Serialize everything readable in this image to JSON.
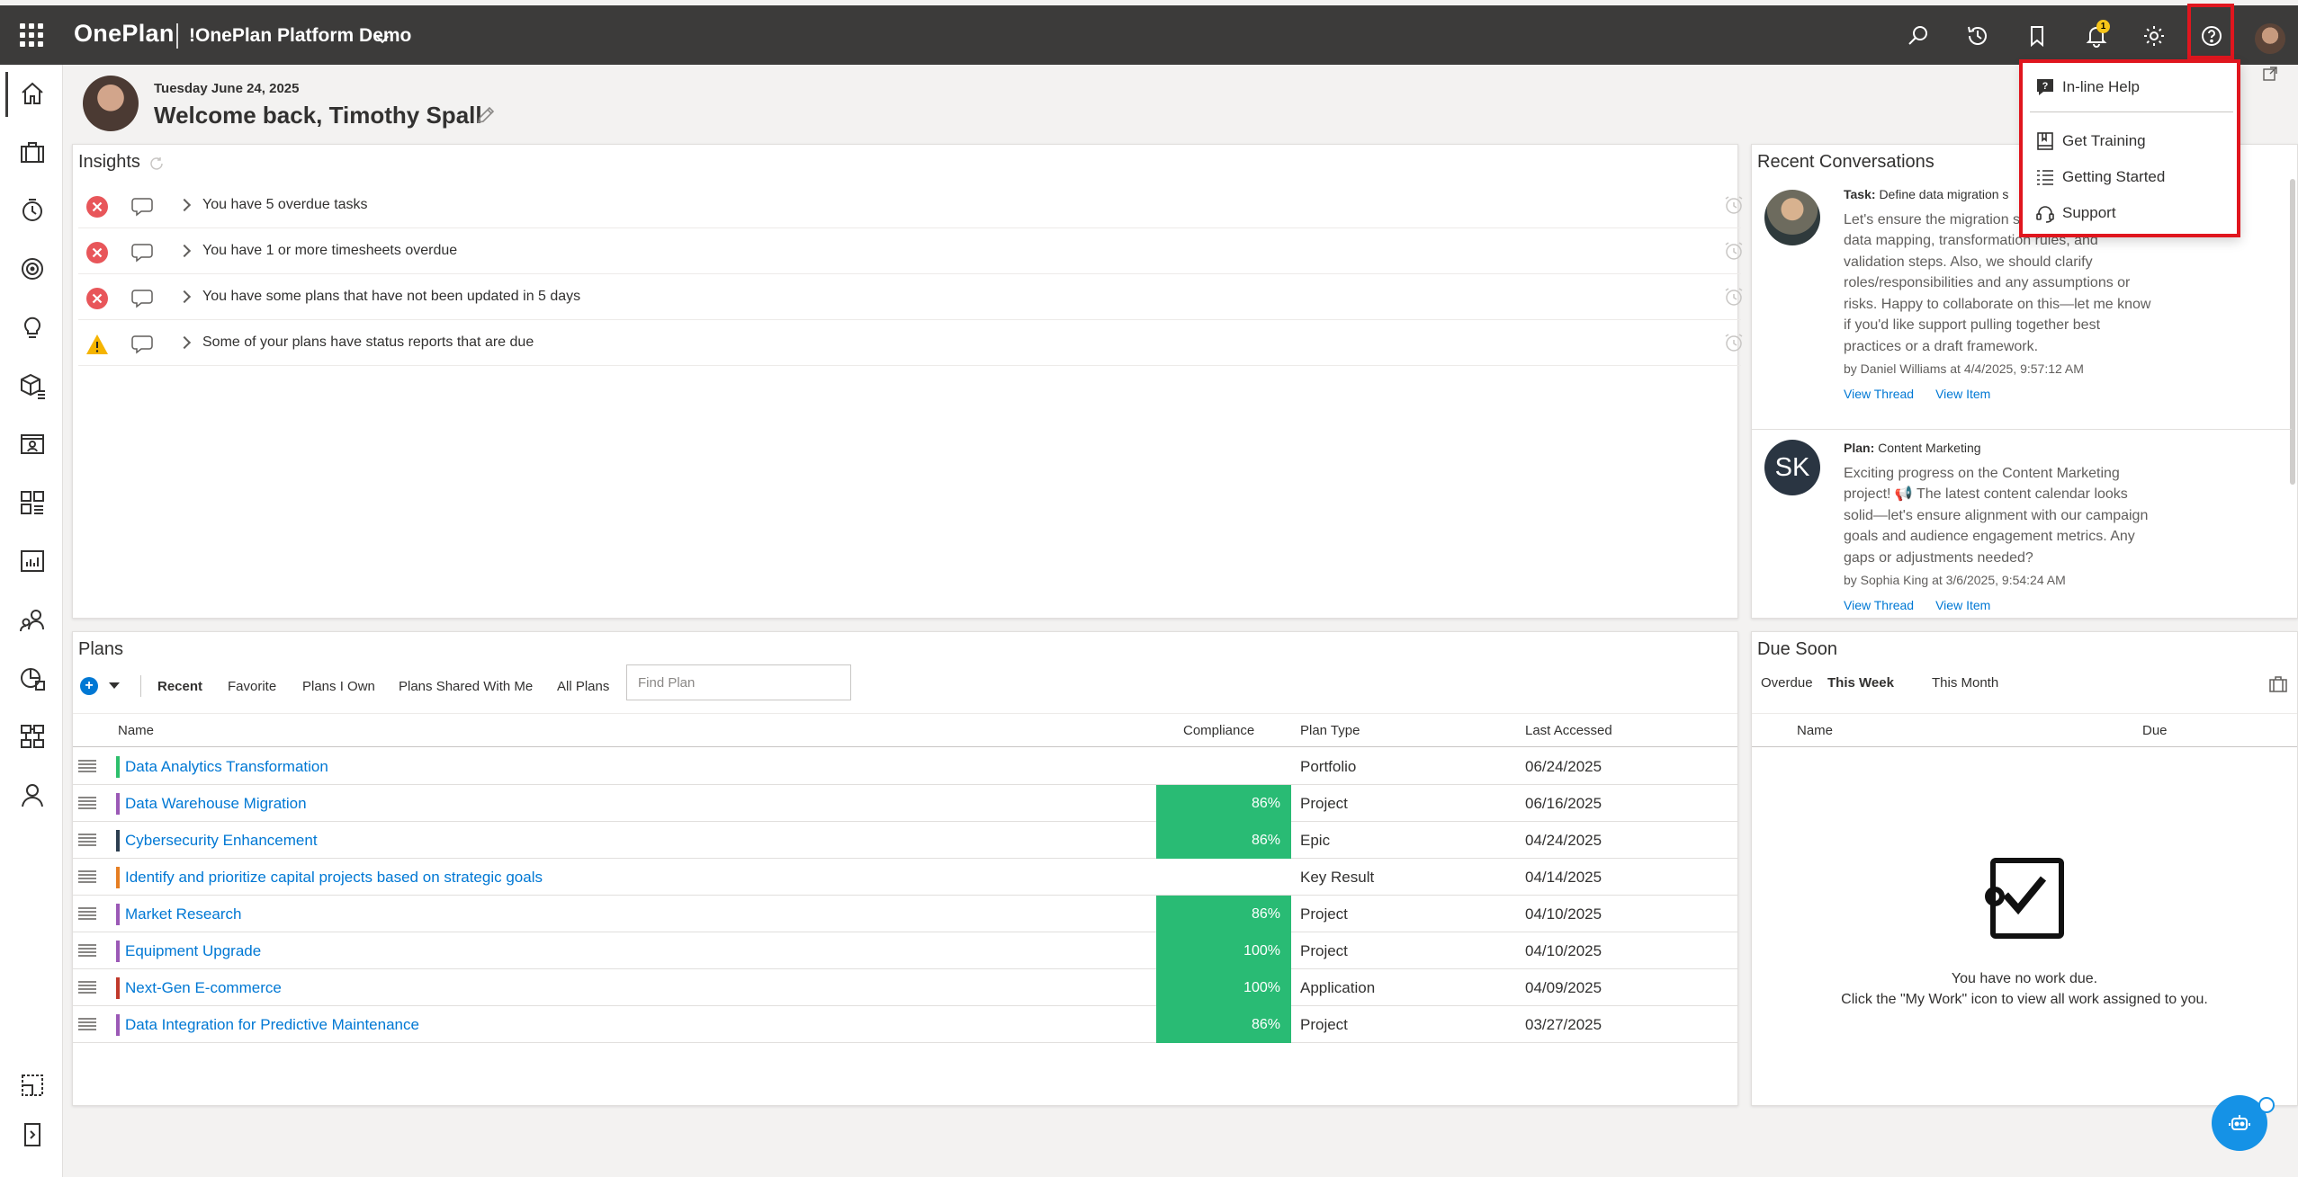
{
  "header": {
    "brand": "OnePlan",
    "workspace": "!OnePlan Platform Demo",
    "notification_count": "1",
    "icons": [
      "search-icon",
      "history-icon",
      "bookmark-icon",
      "bell-icon",
      "gear-icon",
      "help-icon"
    ]
  },
  "left_rail": [
    "home-icon",
    "briefcase-icon",
    "timesheet-icon",
    "target-icon",
    "lightbulb-icon",
    "resources-icon",
    "person-card-icon",
    "dashboard-icon",
    "report-icon",
    "people-icon",
    "portfolio-icon",
    "hierarchy-icon",
    "user-icon",
    "select-icon",
    "expand-rail-icon"
  ],
  "welcome": {
    "date": "Tuesday June 24, 2025",
    "greeting": "Welcome back, Timothy Spall"
  },
  "insights": {
    "title": "Insights",
    "items": [
      {
        "status": "error",
        "text": "You have 5 overdue tasks"
      },
      {
        "status": "error",
        "text": "You have 1 or more timesheets overdue"
      },
      {
        "status": "error",
        "text": "You have some plans that have not been updated in 5 days"
      },
      {
        "status": "warning",
        "text": "Some of your plans have status reports that are due"
      }
    ]
  },
  "conversations": {
    "title": "Recent Conversations",
    "items": [
      {
        "kind": "Task:",
        "subject": "Define data migration s",
        "body": "Let's ensure the migration s the source systems, data mapping, transformation rules, and validation steps. Also, we should clarify roles/responsibilities and any assumptions or risks. Happy to collaborate on this—let me know if you'd like support pulling together best practices or a draft framework.",
        "by": "by Daniel Williams at 4/4/2025, 9:57:12 AM",
        "link1": "View Thread",
        "link2": "View Item"
      },
      {
        "kind": "Plan:",
        "subject": "Content Marketing",
        "initials": "SK",
        "body": "Exciting progress on the Content Marketing project! 📢 The latest content calendar looks solid—let's ensure alignment with our campaign goals and audience engagement metrics. Any gaps or adjustments needed?",
        "by": "by Sophia King at 3/6/2025, 9:54:24 AM",
        "link1": "View Thread",
        "link2": "View Item"
      }
    ]
  },
  "plans": {
    "title": "Plans",
    "tabs": [
      "Recent",
      "Favorite",
      "Plans I Own",
      "Plans Shared With Me",
      "All Plans"
    ],
    "active_tab": "Recent",
    "find_placeholder": "Find Plan",
    "columns": {
      "name": "Name",
      "compliance": "Compliance",
      "type": "Plan Type",
      "accessed": "Last Accessed"
    },
    "rows": [
      {
        "name": "Data Analytics Transformation",
        "color": "#2dbf6c",
        "compliance": "",
        "type": "Portfolio",
        "accessed": "06/24/2025"
      },
      {
        "name": "Data Warehouse Migration",
        "color": "#9b59b6",
        "compliance": "86%",
        "type": "Project",
        "accessed": "06/16/2025"
      },
      {
        "name": "Cybersecurity Enhancement",
        "color": "#2c3e50",
        "compliance": "86%",
        "type": "Epic",
        "accessed": "04/24/2025"
      },
      {
        "name": "Identify and prioritize capital projects based on strategic goals",
        "color": "#e67e22",
        "compliance": "",
        "type": "Key Result",
        "accessed": "04/14/2025"
      },
      {
        "name": "Market Research",
        "color": "#9b59b6",
        "compliance": "86%",
        "type": "Project",
        "accessed": "04/10/2025"
      },
      {
        "name": "Equipment Upgrade",
        "color": "#9b59b6",
        "compliance": "100%",
        "type": "Project",
        "accessed": "04/10/2025"
      },
      {
        "name": "Next-Gen E-commerce",
        "color": "#c0392b",
        "compliance": "100%",
        "type": "Application",
        "accessed": "04/09/2025"
      },
      {
        "name": "Data Integration for Predictive Maintenance",
        "color": "#9b59b6",
        "compliance": "86%",
        "type": "Project",
        "accessed": "03/27/2025"
      }
    ]
  },
  "due_soon": {
    "title": "Due Soon",
    "tabs": [
      "Overdue",
      "This Week",
      "This Month"
    ],
    "active_tab": "This Week",
    "col_name": "Name",
    "col_due": "Due",
    "empty_line1": "You have no work due.",
    "empty_line2": "Click the \"My Work\" icon to view all work assigned to you."
  },
  "help_menu": {
    "items": [
      "In-line Help",
      "Get Training",
      "Getting Started",
      "Support"
    ]
  },
  "colors": {
    "topbar": "#3c3b3a",
    "accent": "#0078d4",
    "compliance": "#29bb74",
    "highlight": "#e0161e"
  }
}
